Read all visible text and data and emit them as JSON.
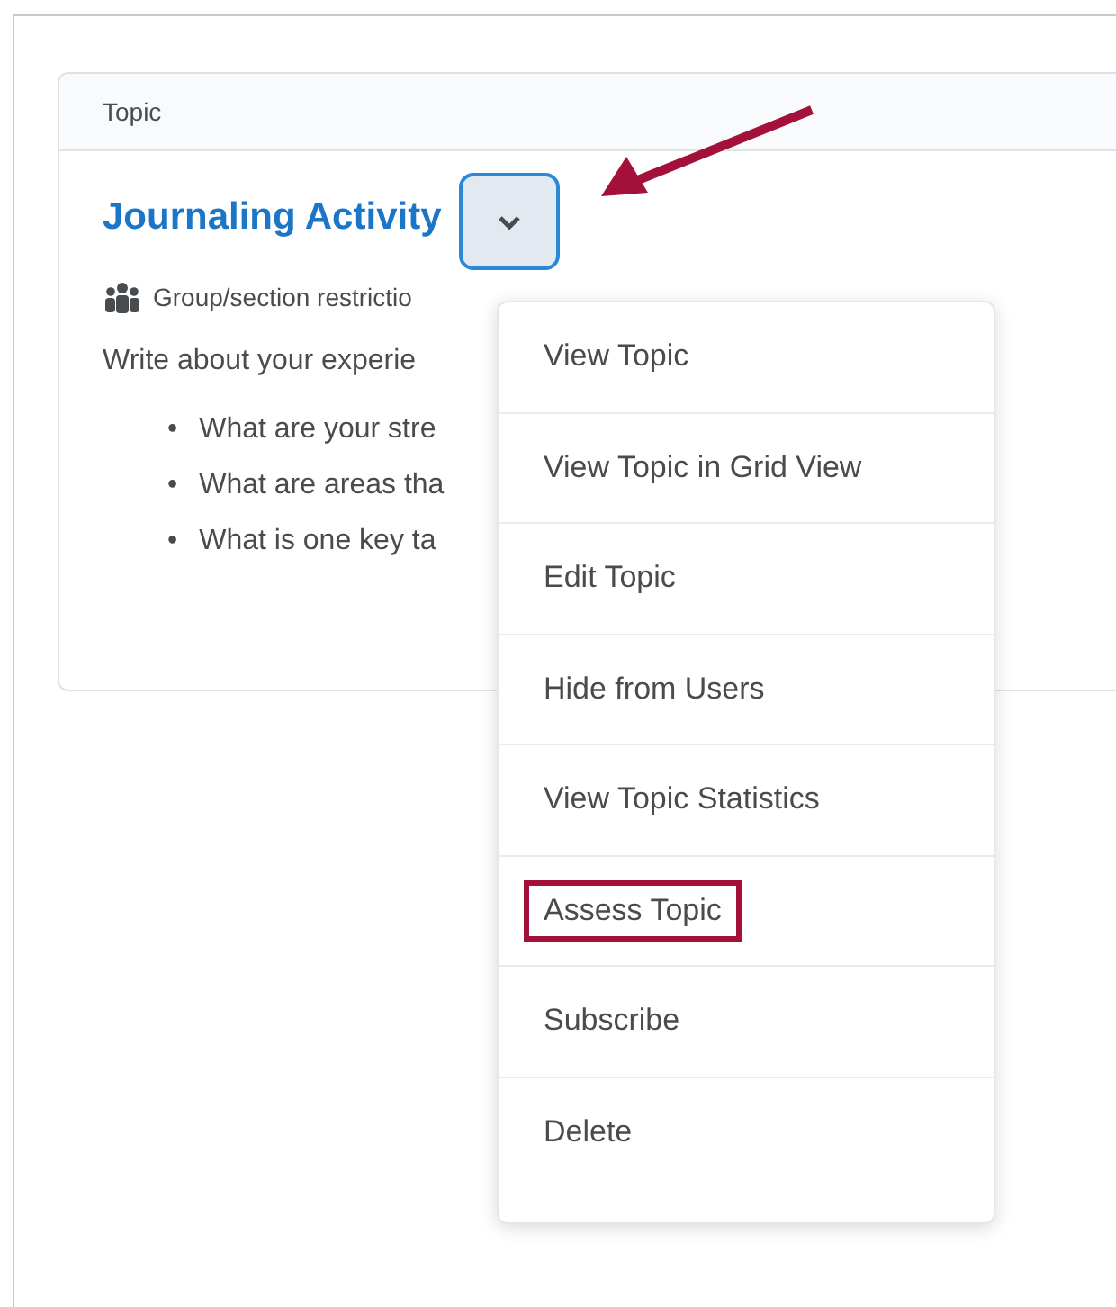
{
  "table": {
    "columns": [
      "Topic"
    ]
  },
  "topic": {
    "title": "Journaling Activity",
    "restriction": "Group/section restrictio",
    "description": "Write about your experie",
    "bullets": [
      {
        "marker": "•",
        "text": "What are your stre"
      },
      {
        "marker": "•",
        "text": "What are areas tha"
      },
      {
        "marker": "•",
        "text": "What is one key ta"
      }
    ]
  },
  "menu": {
    "items": [
      {
        "label": "View Topic",
        "highlighted": false
      },
      {
        "label": "View Topic in Grid View",
        "highlighted": false
      },
      {
        "label": "Edit Topic",
        "highlighted": false
      },
      {
        "label": "Hide from Users",
        "highlighted": false
      },
      {
        "label": "View Topic Statistics",
        "highlighted": false
      },
      {
        "label": "Assess Topic",
        "highlighted": true
      },
      {
        "label": "Subscribe",
        "highlighted": false
      },
      {
        "label": "Delete",
        "highlighted": false
      }
    ]
  }
}
